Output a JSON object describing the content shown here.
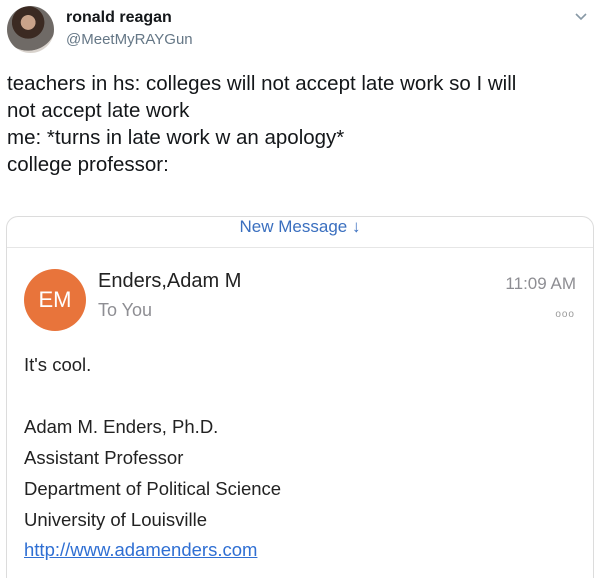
{
  "tweet": {
    "display_name": "ronald reagan",
    "handle": "@MeetMyRAYGun",
    "lines": [
      "teachers in hs: colleges will not accept late work so I will",
      "not accept late work",
      "me: *turns in late work w an apology*",
      "college professor:"
    ],
    "icons": {
      "avatar": "user-avatar",
      "caret": "chevron-down-icon"
    }
  },
  "email": {
    "new_message_label": "New Message",
    "new_message_arrow": "↓",
    "avatar_initials": "EM",
    "avatar_color": "#e8743b",
    "sender": "Enders,Adam M",
    "recipient": "To You",
    "time": "11:09 AM",
    "more_glyph": "ooo",
    "body": "It's cool.",
    "signature": [
      "Adam M. Enders, Ph.D.",
      "Assistant Professor",
      "Department of Political Science",
      "University of Louisville"
    ],
    "link": "http://www.adamenders.com"
  },
  "colors": {
    "link": "#2f6fd3",
    "accent": "#3a6fbf",
    "muted": "#8e8e93"
  }
}
